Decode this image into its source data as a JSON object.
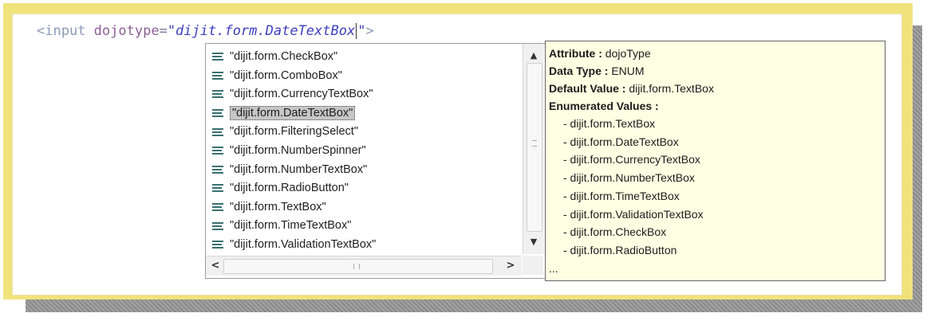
{
  "editor": {
    "code_tag": "<input",
    "code_attr": "dojotype",
    "code_eq": "=",
    "code_value_open": "\"dijit.form.DateTextBox",
    "code_value_close": "\"",
    "code_close": ">"
  },
  "completion_list": {
    "items": [
      {
        "label": "\"dijit.form.CheckBox\"",
        "icon": "enum-value-icon",
        "selected": false
      },
      {
        "label": "\"dijit.form.ComboBox\"",
        "icon": "enum-value-icon",
        "selected": false
      },
      {
        "label": "\"dijit.form.CurrencyTextBox\"",
        "icon": "enum-value-icon",
        "selected": false
      },
      {
        "label": "\"dijit.form.DateTextBox\"",
        "icon": "enum-value-icon",
        "selected": true
      },
      {
        "label": "\"dijit.form.FilteringSelect\"",
        "icon": "enum-value-icon",
        "selected": false
      },
      {
        "label": "\"dijit.form.NumberSpinner\"",
        "icon": "enum-value-icon",
        "selected": false
      },
      {
        "label": "\"dijit.form.NumberTextBox\"",
        "icon": "enum-value-icon",
        "selected": false
      },
      {
        "label": "\"dijit.form.RadioButton\"",
        "icon": "enum-value-icon",
        "selected": false
      },
      {
        "label": "\"dijit.form.TextBox\"",
        "icon": "enum-value-icon",
        "selected": false
      },
      {
        "label": "\"dijit.form.TimeTextBox\"",
        "icon": "enum-value-icon",
        "selected": false
      },
      {
        "label": "\"dijit.form.ValidationTextBox\"",
        "icon": "enum-value-icon",
        "selected": false
      }
    ],
    "scroll_up": "▲",
    "scroll_down": "▼",
    "scroll_left": "<",
    "scroll_right": ">"
  },
  "info_popup": {
    "attribute_label": "Attribute :",
    "attribute_value": "dojoType",
    "data_type_label": "Data Type :",
    "data_type_value": "ENUM",
    "default_label": "Default Value :",
    "default_value": "dijit.form.TextBox",
    "enumerated_label": "Enumerated Values :",
    "enumerated_values": [
      "- dijit.form.TextBox",
      "- dijit.form.DateTextBox",
      "- dijit.form.CurrencyTextBox",
      "- dijit.form.NumberTextBox",
      "- dijit.form.TimeTextBox",
      "- dijit.form.ValidationTextBox",
      "- dijit.form.CheckBox",
      "- dijit.form.RadioButton"
    ],
    "ellipsis": "..."
  },
  "colors": {
    "frame_gold": "#f0e37c",
    "popup_bg": "#ffffe3",
    "code_value": "#3e3fbf"
  }
}
